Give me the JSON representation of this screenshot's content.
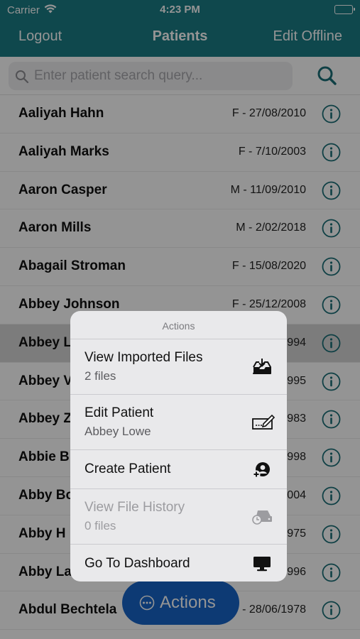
{
  "status": {
    "carrier": "Carrier",
    "time": "4:23 PM"
  },
  "nav": {
    "left": "Logout",
    "title": "Patients",
    "right": "Edit Offline"
  },
  "search": {
    "placeholder": "Enter patient search query..."
  },
  "patients": [
    {
      "name": "Aaliyah Hahn",
      "meta": "F - 27/08/2010"
    },
    {
      "name": "Aaliyah Marks",
      "meta": "F - 7/10/2003"
    },
    {
      "name": "Aaron Casper",
      "meta": "M - 11/09/2010"
    },
    {
      "name": "Aaron Mills",
      "meta": "M - 2/02/2018"
    },
    {
      "name": "Abagail Stroman",
      "meta": "F - 15/08/2020"
    },
    {
      "name": "Abbey Johnson",
      "meta": "F - 25/12/2008"
    },
    {
      "name": "Abbey L",
      "meta": "994"
    },
    {
      "name": "Abbey V",
      "meta": "995"
    },
    {
      "name": "Abbey Z",
      "meta": "983"
    },
    {
      "name": "Abbie B",
      "meta": "998"
    },
    {
      "name": "Abby Bo",
      "meta": "004"
    },
    {
      "name": "Abby H",
      "meta": "975"
    },
    {
      "name": "Abby La",
      "meta": "996"
    },
    {
      "name": "Abdul Bechtela",
      "meta": "- 28/06/1978"
    }
  ],
  "fab": {
    "label": "Actions"
  },
  "menu": {
    "title": "Actions",
    "items": [
      {
        "title": "View Imported Files",
        "subtitle": "2 files",
        "icon": "inbox-download-icon"
      },
      {
        "title": "Edit Patient",
        "subtitle": "Abbey Lowe",
        "icon": "signature-icon"
      },
      {
        "title": "Create Patient",
        "subtitle": "",
        "icon": "add-user-icon"
      },
      {
        "title": "View File History",
        "subtitle": "0 files",
        "icon": "file-history-icon"
      },
      {
        "title": "Go To Dashboard",
        "subtitle": "",
        "icon": "monitor-icon"
      }
    ]
  },
  "colors": {
    "nav": "#1b7c86",
    "accent": "#1a6f77",
    "fab": "#1765c8"
  }
}
